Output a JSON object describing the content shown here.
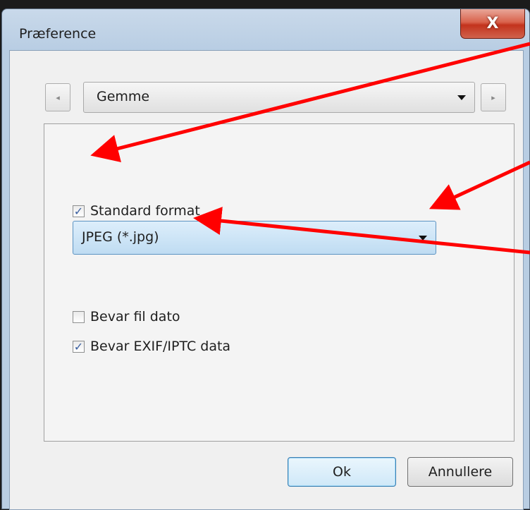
{
  "window": {
    "title": "Præference",
    "close_label": "X"
  },
  "category": {
    "selected": "Gemme",
    "prev_glyph": "◂",
    "next_glyph": "▸"
  },
  "options": {
    "standard_format": {
      "label": "Standard format",
      "checked": true
    },
    "format_select": {
      "selected": "JPEG (*.jpg)"
    },
    "keep_file_date": {
      "label": "Bevar fil dato",
      "checked": false
    },
    "keep_exif": {
      "label": "Bevar EXIF/IPTC data",
      "checked": true
    }
  },
  "buttons": {
    "ok": "Ok",
    "cancel": "Annullere"
  },
  "colors": {
    "annotation_arrow": "#ff0000",
    "close_button": "#c3331d",
    "select_highlight": "#bfdcf2"
  }
}
